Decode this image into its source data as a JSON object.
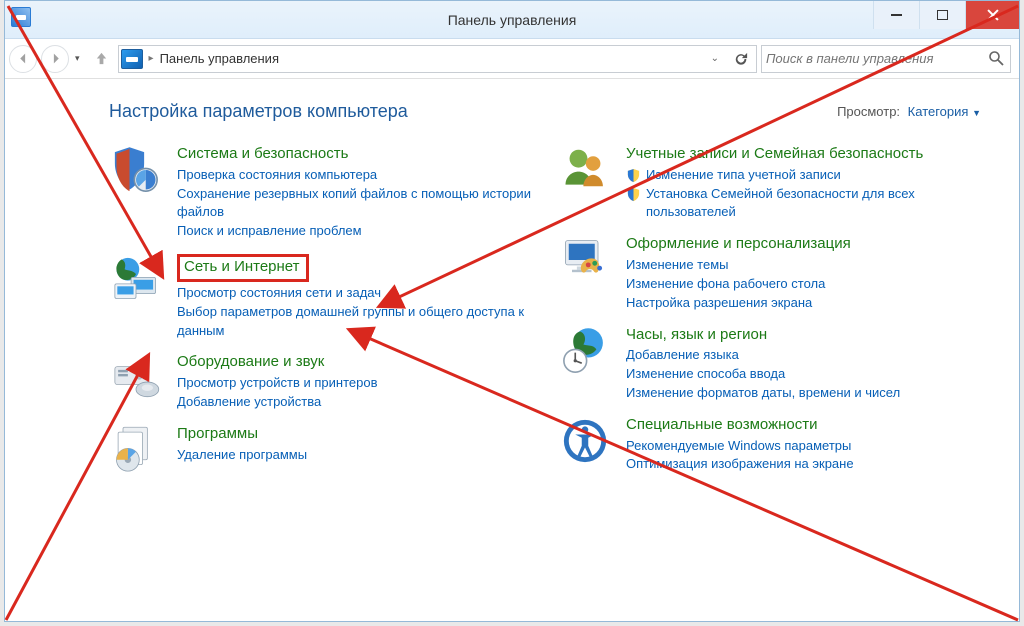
{
  "window": {
    "title": "Панель управления",
    "buttons": {
      "minimize": "Свернуть",
      "maximize": "Развернуть",
      "close": "Закрыть"
    }
  },
  "address": {
    "location_label": "Панель управления"
  },
  "search": {
    "placeholder": "Поиск в панели управления"
  },
  "body_heading": "Настройка параметров компьютера",
  "view_control": {
    "label": "Просмотр:",
    "value": "Категория"
  },
  "categories": {
    "system": {
      "title": "Система и безопасность",
      "links": [
        "Проверка состояния компьютера",
        "Сохранение резервных копий файлов с помощью истории файлов",
        "Поиск и исправление проблем"
      ]
    },
    "network": {
      "title": "Сеть и Интернет",
      "links": [
        "Просмотр состояния сети и задач",
        "Выбор параметров домашней группы и общего доступа к данным"
      ]
    },
    "hardware": {
      "title": "Оборудование и звук",
      "links": [
        "Просмотр устройств и принтеров",
        "Добавление устройства"
      ]
    },
    "programs": {
      "title": "Программы",
      "links": [
        "Удаление программы"
      ]
    },
    "users": {
      "title": "Учетные записи и Семейная безопасность",
      "links": [
        "Изменение типа учетной записи",
        "Установка Семейной безопасности для всех пользователей"
      ]
    },
    "appearance": {
      "title": "Оформление и персонализация",
      "links": [
        "Изменение темы",
        "Изменение фона рабочего стола",
        "Настройка разрешения экрана"
      ]
    },
    "clock": {
      "title": "Часы, язык и регион",
      "links": [
        "Добавление языка",
        "Изменение способа ввода",
        "Изменение форматов даты, времени и чисел"
      ]
    },
    "access": {
      "title": "Специальные возможности",
      "links": [
        "Рекомендуемые Windows параметры",
        "Оптимизация изображения на экране"
      ]
    }
  }
}
